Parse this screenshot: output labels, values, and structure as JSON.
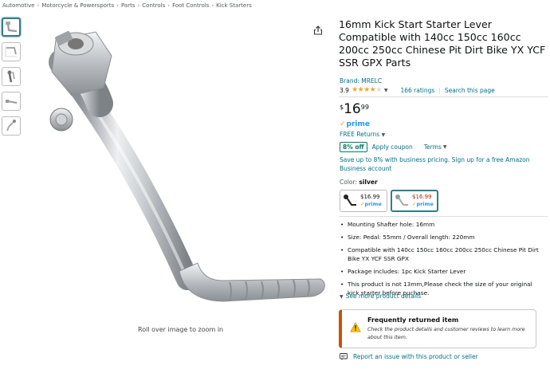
{
  "breadcrumb": {
    "items": [
      "Automotive",
      "Motorcycle & Powersports",
      "Parts",
      "Controls",
      "Foot Controls",
      "Kick Starters"
    ],
    "separator": "›"
  },
  "gallery": {
    "zoom_hint": "Roll over image to zoom in",
    "thumbnail_count": 5,
    "metal_color": "#c8ccd0"
  },
  "product": {
    "title": "16mm Kick Start Starter Lever Compatible with 140cc 150cc 160cc 200cc 250cc Chinese Pit Dirt Bike YX YCF SSR GPX Parts",
    "brand": "Brand: MRELC",
    "rating_value": "3.9",
    "rating_stars": 3.9,
    "ratings_count": "166 ratings",
    "search_page": "Search this page",
    "price_symbol": "$",
    "price_whole": "16",
    "price_fraction": "99",
    "prime_label": "prime",
    "free_returns": "FREE Returns",
    "coupon_badge": "8% off",
    "apply_coupon": "Apply coupon",
    "terms": "Terms",
    "business_text": "Save up to 8% with business pricing. Sign up for a free Amazon Business account",
    "color_label": "Color:",
    "color_value": "silver"
  },
  "swatches": [
    {
      "price": "$16.99",
      "prime": "prime",
      "selected": false
    },
    {
      "price": "$16.99",
      "prime": "prime",
      "selected": true
    }
  ],
  "bullets": [
    "Mounting Shafter hole: 16mm",
    "Size: Pedal: 55mm / Overall length: 220mm",
    "Compatible with 140cc 150cc 160cc 200cc 250cc Chinese Pit Dirt Bike YX YCF SSR GPX",
    "Package includes: 1pc Kick Starter Lever",
    "This product is not 13mm,Please check the size of your original kick starter before puchase."
  ],
  "see_more": "See more product details",
  "returned": {
    "title": "Frequently returned item",
    "body": "Check the product details and customer reviews to learn more about this item."
  },
  "report_issue": "Report an issue with this product or seller",
  "colors": {
    "link": "#007185",
    "prime_blue": "#1a98ff",
    "star": "#f5a623",
    "deal_green": "#067d62",
    "warning_border": "#c45500",
    "warning_fill": "#ffc400",
    "selected_border": "#2f7f87",
    "price_red": "#b12704"
  }
}
